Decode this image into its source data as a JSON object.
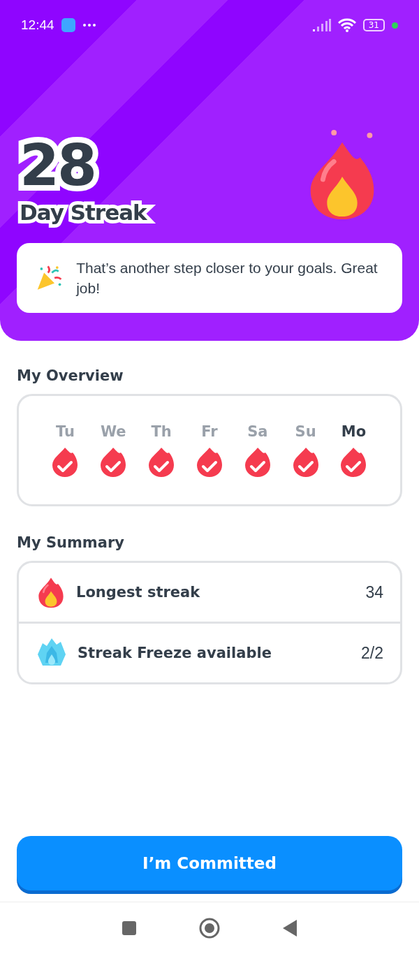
{
  "status_bar": {
    "time": "12:44",
    "battery": "31"
  },
  "streak": {
    "count": "28",
    "label": "Day Streak",
    "message": "That’s another step closer to your goals. Great job!"
  },
  "overview": {
    "title": "My Overview",
    "days": [
      {
        "label": "Tu",
        "selected": false,
        "done": true
      },
      {
        "label": "We",
        "selected": false,
        "done": true
      },
      {
        "label": "Th",
        "selected": false,
        "done": true
      },
      {
        "label": "Fr",
        "selected": false,
        "done": true
      },
      {
        "label": "Sa",
        "selected": false,
        "done": true
      },
      {
        "label": "Su",
        "selected": false,
        "done": true
      },
      {
        "label": "Mo",
        "selected": true,
        "done": true
      }
    ]
  },
  "summary": {
    "title": "My Summary",
    "items": [
      {
        "kind": "fire",
        "label": "Longest streak",
        "value": "34"
      },
      {
        "kind": "freeze",
        "label": "Streak Freeze available",
        "value": "2/2"
      }
    ]
  },
  "button": {
    "label": "I’m Committed"
  }
}
